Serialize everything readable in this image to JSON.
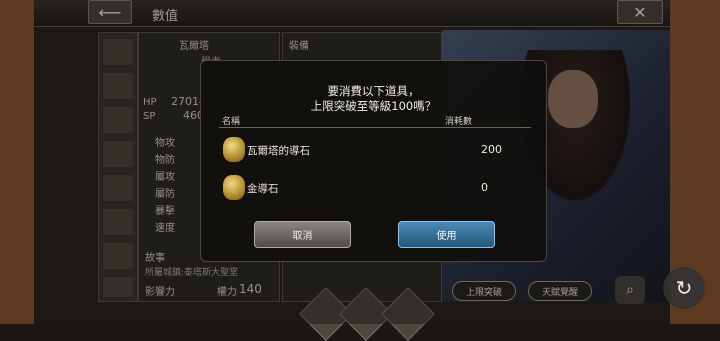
{
  "header": {
    "title": "數值"
  },
  "character": {
    "name": "瓦爾塔",
    "class_label": "學者"
  },
  "stats_bg": {
    "hp_label": "HP",
    "hp_value": "27014",
    "sp_label": "SP",
    "sp_value": "460",
    "stats": [
      "物攻",
      "物防",
      "屬攻",
      "屬防",
      "暴擊",
      "速度"
    ]
  },
  "equip_bg": {
    "title": "裝備"
  },
  "story": {
    "label": "故事",
    "origin": "所屬城鎮:泰塔斯大聖堂"
  },
  "influence": {
    "label": "影響力",
    "sub": "權力",
    "value": "140"
  },
  "dialog": {
    "message_line1": "要消費以下道具，",
    "message_line2": "上限突破至等級100嗎？",
    "col_name": "名稱",
    "col_cost": "消耗數",
    "items": [
      {
        "name": "瓦爾塔的導石",
        "cost": "200"
      },
      {
        "name": "金導石",
        "cost": "0"
      }
    ],
    "cancel_label": "取消",
    "use_label": "使用"
  },
  "bottom": {
    "limit_break_label": "上限突破",
    "talent_label": "天賦覺醒"
  },
  "icons": {
    "back": "back-arrow-icon",
    "close": "close-icon",
    "reload": "reload-icon",
    "search": "search-icon"
  }
}
